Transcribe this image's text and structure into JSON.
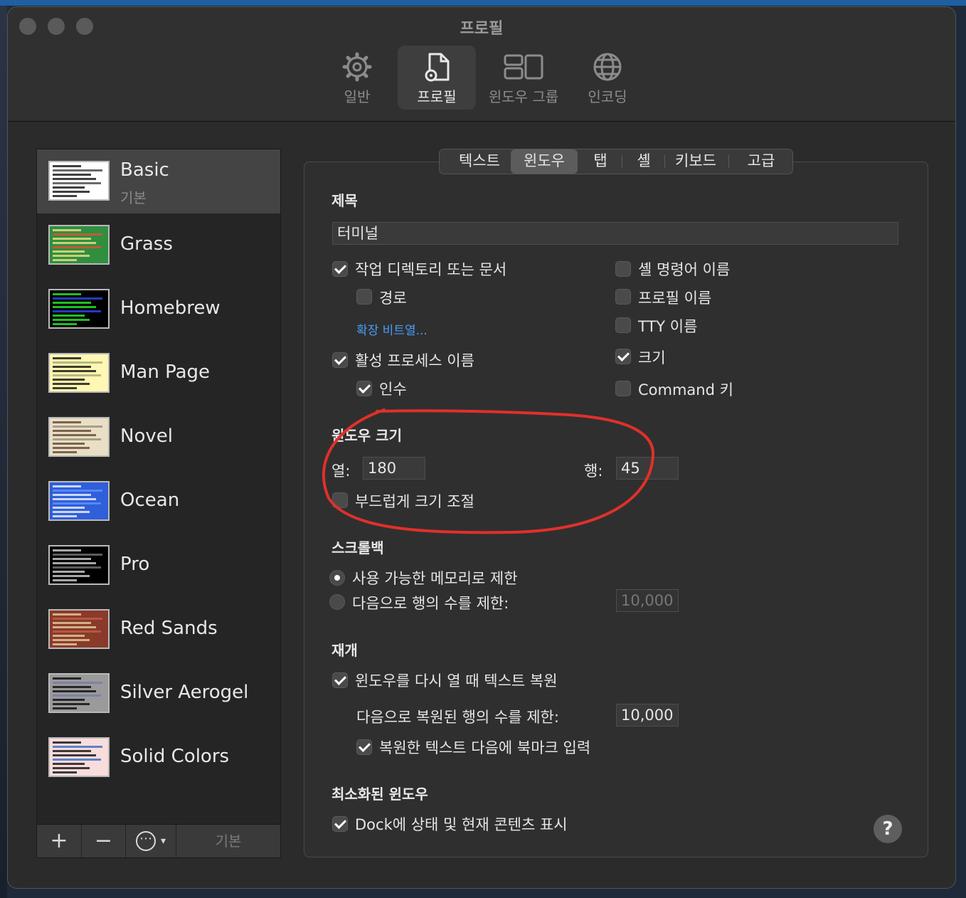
{
  "window": {
    "title": "프로필"
  },
  "toolbar": {
    "items": [
      {
        "label": "일반",
        "icon": "gear-icon"
      },
      {
        "label": "프로필",
        "icon": "document-gear-icon"
      },
      {
        "label": "윈도우 그룹",
        "icon": "windows-icon"
      },
      {
        "label": "인코딩",
        "icon": "globe-icon"
      }
    ]
  },
  "sidebar": {
    "profiles": [
      {
        "name": "Basic",
        "subtitle": "기본",
        "colors": {
          "bg": "#ffffff",
          "fg": "#000000",
          "accent": "#5a5a5a"
        }
      },
      {
        "name": "Grass",
        "colors": {
          "bg": "#2f8f3f",
          "fg": "#ffe58a",
          "accent": "#d2553a"
        }
      },
      {
        "name": "Homebrew",
        "colors": {
          "bg": "#000000",
          "fg": "#2cff2c",
          "accent": "#2a3fd9"
        }
      },
      {
        "name": "Man Page",
        "colors": {
          "bg": "#fff7b3",
          "fg": "#000000",
          "accent": "#b2b27a"
        }
      },
      {
        "name": "Novel",
        "colors": {
          "bg": "#e8dfc5",
          "fg": "#5a3a2a",
          "accent": "#a09880"
        }
      },
      {
        "name": "Ocean",
        "colors": {
          "bg": "#2f5fd9",
          "fg": "#ffffff",
          "accent": "#5c8bff"
        }
      },
      {
        "name": "Pro",
        "colors": {
          "bg": "#000000",
          "fg": "#e0e0e0",
          "accent": "#666666"
        }
      },
      {
        "name": "Red Sands",
        "colors": {
          "bg": "#8a3a2a",
          "fg": "#e8d8a8",
          "accent": "#b85c44"
        }
      },
      {
        "name": "Silver Aerogel",
        "colors": {
          "bg": "#9a9a9a",
          "fg": "#000000",
          "accent": "#7a7fa8"
        }
      },
      {
        "name": "Solid Colors",
        "colors": {
          "bg": "#f9dcdc",
          "fg": "#000000",
          "accent": "#4a78c8"
        }
      }
    ],
    "footer": {
      "add": "+",
      "remove": "−",
      "more": "⋯",
      "default": "기본"
    }
  },
  "tabs": [
    "텍스트",
    "윈도우",
    "탭",
    "셸",
    "키보드",
    "고급"
  ],
  "title_section": {
    "heading": "제목",
    "title_value": "터미널",
    "options": {
      "working_dir": "작업 디렉토리 또는 문서",
      "path": "경로",
      "encoding_link": "확장 비트열...",
      "active_process": "활성 프로세스 이름",
      "arguments": "인수",
      "shell_command": "셸 명령어 이름",
      "profile_name": "프로필 이름",
      "tty_name": "TTY 이름",
      "dimensions": "크기",
      "command_key": "Command 키"
    }
  },
  "window_size": {
    "heading": "윈도우 크기",
    "columns_label": "열:",
    "columns_value": "180",
    "rows_label": "행:",
    "rows_value": "45",
    "smooth_resize": "부드럽게 크기 조절"
  },
  "scrollback": {
    "heading": "스크롤백",
    "limit_memory": "사용 가능한 메모리로 제한",
    "limit_rows": "다음으로 행의 수를 제한:",
    "rows_value": "10,000"
  },
  "restore": {
    "heading": "재개",
    "restore_text": "윈도우를 다시 열 때 텍스트 복원",
    "limit_restored": "다음으로 복원된 행의 수를 제한:",
    "restored_value": "10,000",
    "bookmark": "복원한 텍스트 다음에 북마크 입력"
  },
  "minimized": {
    "heading": "최소화된 윈도우",
    "dock_status": "Dock에 상태 및 현재 콘텐츠 표시"
  },
  "help": "?",
  "annotation_color": "#e0302a"
}
